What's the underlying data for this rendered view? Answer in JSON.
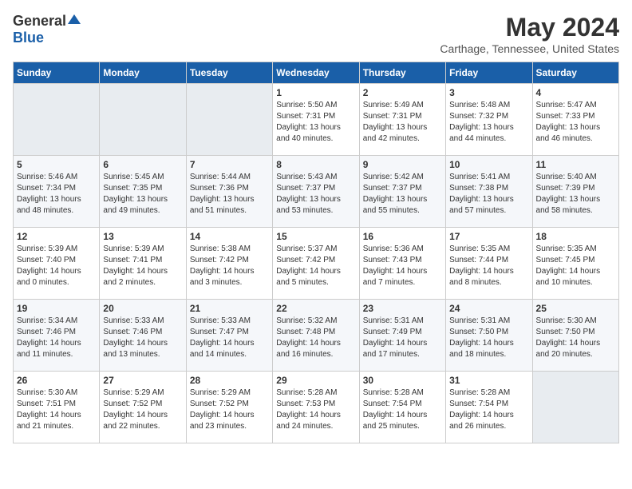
{
  "header": {
    "logo_general": "General",
    "logo_blue": "Blue",
    "month": "May 2024",
    "location": "Carthage, Tennessee, United States"
  },
  "days_of_week": [
    "Sunday",
    "Monday",
    "Tuesday",
    "Wednesday",
    "Thursday",
    "Friday",
    "Saturday"
  ],
  "weeks": [
    [
      {
        "day": "",
        "empty": true
      },
      {
        "day": "",
        "empty": true
      },
      {
        "day": "",
        "empty": true
      },
      {
        "day": "1",
        "sunrise": "5:50 AM",
        "sunset": "7:31 PM",
        "daylight": "13 hours and 40 minutes."
      },
      {
        "day": "2",
        "sunrise": "5:49 AM",
        "sunset": "7:31 PM",
        "daylight": "13 hours and 42 minutes."
      },
      {
        "day": "3",
        "sunrise": "5:48 AM",
        "sunset": "7:32 PM",
        "daylight": "13 hours and 44 minutes."
      },
      {
        "day": "4",
        "sunrise": "5:47 AM",
        "sunset": "7:33 PM",
        "daylight": "13 hours and 46 minutes."
      }
    ],
    [
      {
        "day": "5",
        "sunrise": "5:46 AM",
        "sunset": "7:34 PM",
        "daylight": "13 hours and 48 minutes."
      },
      {
        "day": "6",
        "sunrise": "5:45 AM",
        "sunset": "7:35 PM",
        "daylight": "13 hours and 49 minutes."
      },
      {
        "day": "7",
        "sunrise": "5:44 AM",
        "sunset": "7:36 PM",
        "daylight": "13 hours and 51 minutes."
      },
      {
        "day": "8",
        "sunrise": "5:43 AM",
        "sunset": "7:37 PM",
        "daylight": "13 hours and 53 minutes."
      },
      {
        "day": "9",
        "sunrise": "5:42 AM",
        "sunset": "7:37 PM",
        "daylight": "13 hours and 55 minutes."
      },
      {
        "day": "10",
        "sunrise": "5:41 AM",
        "sunset": "7:38 PM",
        "daylight": "13 hours and 57 minutes."
      },
      {
        "day": "11",
        "sunrise": "5:40 AM",
        "sunset": "7:39 PM",
        "daylight": "13 hours and 58 minutes."
      }
    ],
    [
      {
        "day": "12",
        "sunrise": "5:39 AM",
        "sunset": "7:40 PM",
        "daylight": "14 hours and 0 minutes."
      },
      {
        "day": "13",
        "sunrise": "5:39 AM",
        "sunset": "7:41 PM",
        "daylight": "14 hours and 2 minutes."
      },
      {
        "day": "14",
        "sunrise": "5:38 AM",
        "sunset": "7:42 PM",
        "daylight": "14 hours and 3 minutes."
      },
      {
        "day": "15",
        "sunrise": "5:37 AM",
        "sunset": "7:42 PM",
        "daylight": "14 hours and 5 minutes."
      },
      {
        "day": "16",
        "sunrise": "5:36 AM",
        "sunset": "7:43 PM",
        "daylight": "14 hours and 7 minutes."
      },
      {
        "day": "17",
        "sunrise": "5:35 AM",
        "sunset": "7:44 PM",
        "daylight": "14 hours and 8 minutes."
      },
      {
        "day": "18",
        "sunrise": "5:35 AM",
        "sunset": "7:45 PM",
        "daylight": "14 hours and 10 minutes."
      }
    ],
    [
      {
        "day": "19",
        "sunrise": "5:34 AM",
        "sunset": "7:46 PM",
        "daylight": "14 hours and 11 minutes."
      },
      {
        "day": "20",
        "sunrise": "5:33 AM",
        "sunset": "7:46 PM",
        "daylight": "14 hours and 13 minutes."
      },
      {
        "day": "21",
        "sunrise": "5:33 AM",
        "sunset": "7:47 PM",
        "daylight": "14 hours and 14 minutes."
      },
      {
        "day": "22",
        "sunrise": "5:32 AM",
        "sunset": "7:48 PM",
        "daylight": "14 hours and 16 minutes."
      },
      {
        "day": "23",
        "sunrise": "5:31 AM",
        "sunset": "7:49 PM",
        "daylight": "14 hours and 17 minutes."
      },
      {
        "day": "24",
        "sunrise": "5:31 AM",
        "sunset": "7:50 PM",
        "daylight": "14 hours and 18 minutes."
      },
      {
        "day": "25",
        "sunrise": "5:30 AM",
        "sunset": "7:50 PM",
        "daylight": "14 hours and 20 minutes."
      }
    ],
    [
      {
        "day": "26",
        "sunrise": "5:30 AM",
        "sunset": "7:51 PM",
        "daylight": "14 hours and 21 minutes."
      },
      {
        "day": "27",
        "sunrise": "5:29 AM",
        "sunset": "7:52 PM",
        "daylight": "14 hours and 22 minutes."
      },
      {
        "day": "28",
        "sunrise": "5:29 AM",
        "sunset": "7:52 PM",
        "daylight": "14 hours and 23 minutes."
      },
      {
        "day": "29",
        "sunrise": "5:28 AM",
        "sunset": "7:53 PM",
        "daylight": "14 hours and 24 minutes."
      },
      {
        "day": "30",
        "sunrise": "5:28 AM",
        "sunset": "7:54 PM",
        "daylight": "14 hours and 25 minutes."
      },
      {
        "day": "31",
        "sunrise": "5:28 AM",
        "sunset": "7:54 PM",
        "daylight": "14 hours and 26 minutes."
      },
      {
        "day": "",
        "empty": true
      }
    ]
  ]
}
